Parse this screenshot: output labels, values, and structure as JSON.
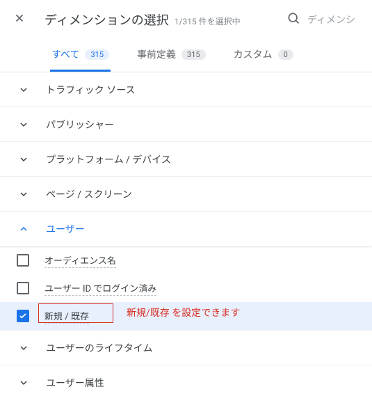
{
  "header": {
    "title": "ディメンションの選択",
    "subtitle": "1/315 件を選択中",
    "search_placeholder": "ディメンシ"
  },
  "tabs": {
    "all": {
      "label": "すべて",
      "count": "315"
    },
    "predefined": {
      "label": "事前定義",
      "count": "315"
    },
    "custom": {
      "label": "カスタム",
      "count": "0"
    }
  },
  "groups": {
    "traffic_source": {
      "label": "トラフィック ソース"
    },
    "publisher": {
      "label": "パブリッシャー"
    },
    "platform_device": {
      "label": "プラットフォーム / デバイス"
    },
    "page_screen": {
      "label": "ページ / スクリーン"
    },
    "user": {
      "label": "ユーザー"
    },
    "user_lifetime": {
      "label": "ユーザーのライフタイム"
    },
    "user_attributes": {
      "label": "ユーザー属性"
    }
  },
  "user_items": {
    "audience_name": {
      "label": "オーディエンス名"
    },
    "logged_in_userid": {
      "label": "ユーザー ID でログイン済み"
    },
    "new_returning": {
      "label": "新規 / 既存"
    }
  },
  "annotation": {
    "text": "新規/既存 を設定できます"
  }
}
